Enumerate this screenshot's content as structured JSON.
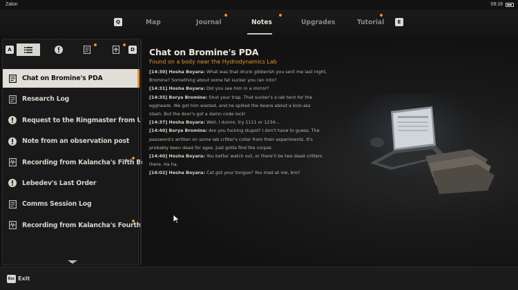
{
  "status_bar": {
    "carrier": "Zalon",
    "time": "09:16"
  },
  "nav": {
    "left_key": "Q",
    "right_key": "E",
    "tabs": [
      {
        "label": "Map",
        "active": false,
        "notification": false
      },
      {
        "label": "Journal",
        "active": false,
        "notification": true
      },
      {
        "label": "Notes",
        "active": true,
        "notification": true
      },
      {
        "label": "Upgrades",
        "active": false,
        "notification": false
      },
      {
        "label": "Tutorial",
        "active": false,
        "notification": true
      }
    ]
  },
  "filters": {
    "left_key": "A",
    "right_key": "D",
    "buttons": [
      {
        "icon": "list-icon",
        "active": true,
        "notification": false
      },
      {
        "icon": "exclamation-icon",
        "active": false,
        "notification": false
      },
      {
        "icon": "document-icon",
        "active": false,
        "notification": true
      },
      {
        "icon": "audio-wave-icon",
        "active": false,
        "notification": true
      }
    ]
  },
  "notes": [
    {
      "label": "Chat on Bromine's PDA",
      "icon": "document-icon",
      "selected": true,
      "notification": false
    },
    {
      "label": "Research Log",
      "icon": "document-icon",
      "selected": false,
      "notification": false
    },
    {
      "label": "Request to the Ringmaster from Unknown",
      "icon": "exclamation-icon",
      "selected": false,
      "notification": false
    },
    {
      "label": "Note from an observation post",
      "icon": "exclamation-icon",
      "selected": false,
      "notification": false
    },
    {
      "label": "Recording from Kalancha's Fifth Beacon",
      "icon": "audio-wave-icon",
      "selected": false,
      "notification": true
    },
    {
      "label": "Lebedev's Last Order",
      "icon": "exclamation-icon",
      "selected": false,
      "notification": false
    },
    {
      "label": "Comms Session Log",
      "icon": "document-icon",
      "selected": false,
      "notification": false
    },
    {
      "label": "Recording from Kalancha's Fourth Beacon",
      "icon": "audio-wave-icon",
      "selected": false,
      "notification": true
    }
  ],
  "note": {
    "title": "Chat on Bromine's PDA",
    "subtitle": "Found on a body near the Hydrodynamics Lab",
    "lines": [
      {
        "speaker": "[14:30] Hosha Boyara:",
        "text": " What was that drunk gibberish you sent me last night,"
      },
      {
        "speaker": "",
        "text": "Bromine? Something about some fat sucker you ran into?"
      },
      {
        "speaker": "[14:31] Hosha Boyara:",
        "text": " Did you see him in a mirror?"
      },
      {
        "speaker": "[14:35] Borya Bromine:",
        "text": " Shut your trap. That sucker's a lab tech for the"
      },
      {
        "speaker": "",
        "text": "eggheads. We got him wasted, and he spilled the beans about a kick-ass"
      },
      {
        "speaker": "",
        "text": "stash. But the door's got a damn code lock!"
      },
      {
        "speaker": "[14:37] Hosha Boyara:",
        "text": " Well, I dunno, try 1111 or 1234..."
      },
      {
        "speaker": "[14:40] Borya Bromine:",
        "text": " Are you fucking stupid? I don't have to guess. The"
      },
      {
        "speaker": "",
        "text": "password's written on some lab critter's collar from their experiments. It's"
      },
      {
        "speaker": "",
        "text": "probably been dead for ages. Just gotta find the corpse."
      },
      {
        "speaker": "[14:40] Hosha Boyara:",
        "text": " You better watch out, or there'll be two dead critters"
      },
      {
        "speaker": "",
        "text": "there. Ha ha."
      },
      {
        "speaker": "[16:02] Hosha Boyara:",
        "text": " Cat got your tongue? You mad at me, bro?"
      }
    ]
  },
  "bottom": {
    "exit_key": "Esc",
    "exit_label": "Exit"
  },
  "colors": {
    "accent": "#e9932a",
    "selected_bg": "#e2dfd8"
  }
}
